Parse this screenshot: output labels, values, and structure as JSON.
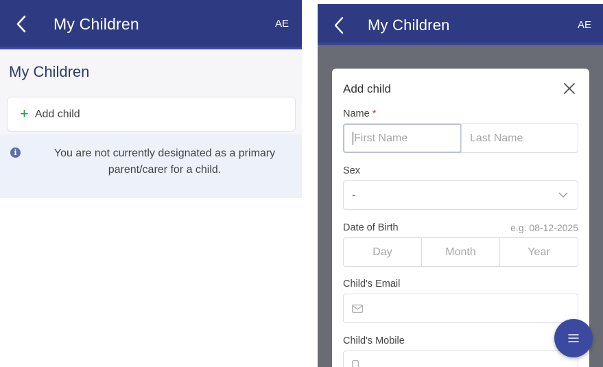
{
  "left": {
    "appbar": {
      "title": "My Children",
      "avatar": "AE"
    },
    "section_title": "My Children",
    "add_child_label": "Add child",
    "info_text": "You are not currently designated as a primary parent/carer for a child."
  },
  "right": {
    "appbar": {
      "title": "My Children",
      "avatar": "AE"
    },
    "modal": {
      "title": "Add child",
      "name": {
        "label": "Name",
        "required": "*",
        "first_placeholder": "First Name",
        "last_placeholder": "Last Name"
      },
      "sex": {
        "label": "Sex",
        "value": "-"
      },
      "dob": {
        "label": "Date of Birth",
        "hint": "e.g. 08-12-2025",
        "day": "Day",
        "month": "Month",
        "year": "Year"
      },
      "email": {
        "label": "Child's Email"
      },
      "mobile": {
        "label": "Child's Mobile"
      }
    }
  },
  "colors": {
    "primary": "#2e3a82",
    "accent_green": "#2e9a4c",
    "info_bg": "#edf1fa",
    "required": "#d23b3b"
  },
  "icons": [
    "chevron-left-icon",
    "plus-icon",
    "info-icon",
    "close-icon",
    "chevron-down-icon",
    "mail-icon",
    "phone-icon",
    "menu-icon"
  ]
}
